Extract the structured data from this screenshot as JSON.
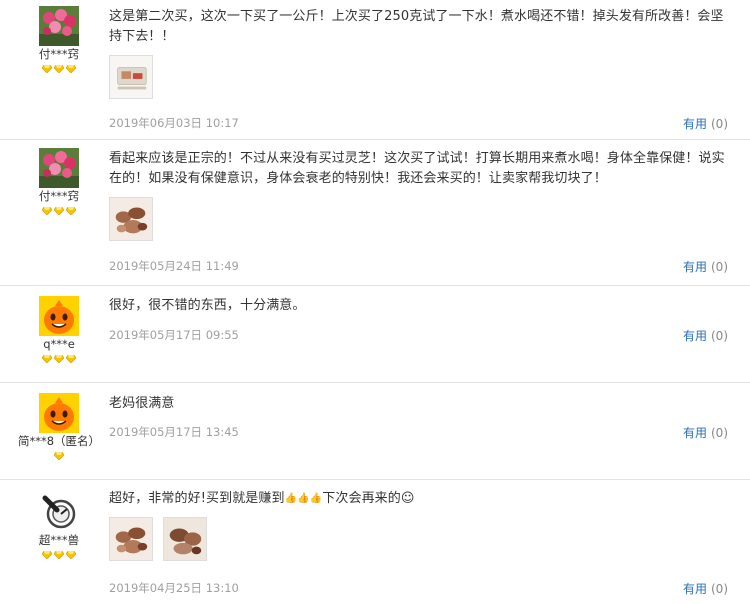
{
  "reviews": [
    {
      "user": "付***窍",
      "avatar": "flower-avatar",
      "text": "这是第二次买，这次一下买了一公斤！上次买了250克试了一下水！煮水喝还不错！掉头发有所改善！会坚持下去！！",
      "date": "2019年06月03日 10:17",
      "useful_label": "有用",
      "useful_count": "(0)"
    },
    {
      "user": "付***窍",
      "avatar": "flower-avatar",
      "text": "看起来应该是正宗的！不过从来没有买过灵芝！这次买了试试！打算长期用来煮水喝！身体全靠保健！说实在的！如果没有保健意识，身体会衰老的特别快！我还会来买的！让卖家帮我切块了！",
      "date": "2019年05月24日 11:49",
      "useful_label": "有用",
      "useful_count": "(0)"
    },
    {
      "user": "q***e",
      "avatar": "orange-mascot-avatar",
      "text": "很好，很不错的东西，十分满意。",
      "date": "2019年05月17日 09:55",
      "useful_label": "有用",
      "useful_count": "(0)"
    },
    {
      "user": "简***8（匿名）",
      "avatar": "orange-mascot-avatar",
      "text": "老妈很满意",
      "date": "2019年05月17日 13:45",
      "useful_label": "有用",
      "useful_count": "(0)"
    },
    {
      "user": "超***兽",
      "avatar": "cartoon-avatar",
      "text_before": "超好，非常的好!买到就是赚到",
      "text_after": "下次会再来的",
      "emoji": "👍👍👍",
      "smiley": "☺",
      "date": "2019年04月25日 13:10",
      "useful_label": "有用",
      "useful_count": "(0)"
    }
  ],
  "colors": {
    "link": "#2a6fb5",
    "date": "#a0a0a0",
    "badge": "#f6c400",
    "divider": "#e3e3e3"
  }
}
